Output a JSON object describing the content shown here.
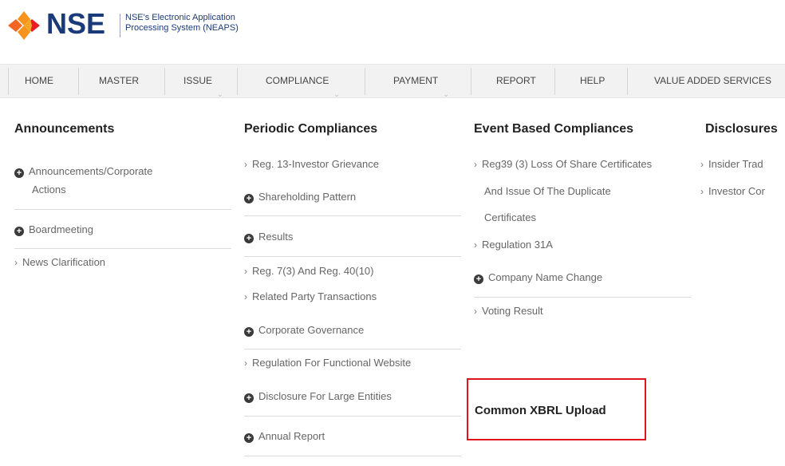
{
  "header": {
    "brand": "NSE",
    "subtitle_line1": "NSE's Electronic Application",
    "subtitle_line2": "Processing System (NEAPS)"
  },
  "nav": [
    "HOME",
    "MASTER",
    "ISSUE",
    "COMPLIANCE",
    "PAYMENT",
    "REPORT",
    "HELP",
    "VALUE ADDED SERVICES"
  ],
  "announcements": {
    "title": "Announcements",
    "items": [
      {
        "label_line1": "Announcements/Corporate",
        "label_line2": "Actions"
      },
      {
        "label": "Boardmeeting"
      },
      {
        "label": "News Clarification"
      }
    ]
  },
  "periodic": {
    "title": "Periodic Compliances",
    "items": [
      "Reg. 13-Investor Grievance",
      "Shareholding Pattern",
      "Results",
      "Reg. 7(3) And Reg. 40(10)",
      "Related Party Transactions",
      "Corporate Governance",
      "Regulation For Functional Website",
      "Disclosure For Large Entities",
      "Annual Report"
    ]
  },
  "event": {
    "title": "Event Based Compliances",
    "items": [
      {
        "line1": "Reg39 (3) Loss Of Share Certificates",
        "line2": "And Issue Of The Duplicate",
        "line3": "Certificates"
      },
      "Regulation 31A",
      "Company Name Change",
      "Voting Result"
    ],
    "xbrl_label": "Common XBRL Upload"
  },
  "disclosures": {
    "title": "Disclosures",
    "items": [
      "Insider Trad",
      "Investor Cor"
    ]
  }
}
